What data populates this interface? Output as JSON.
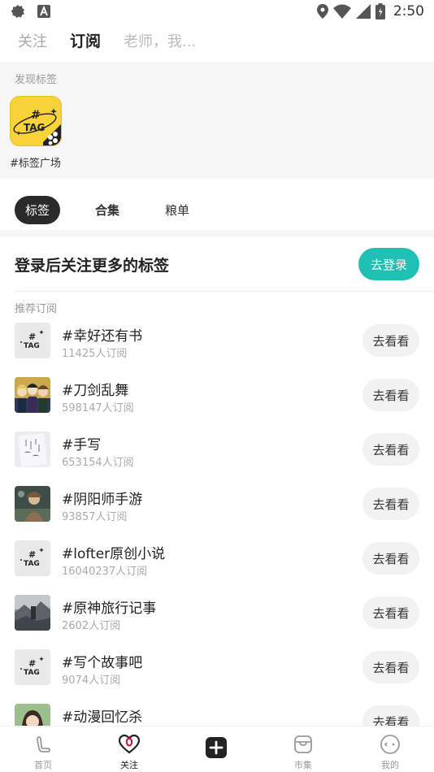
{
  "status_bar": {
    "time": "2:50"
  },
  "top_tabs": [
    {
      "label": "关注"
    },
    {
      "label": "订阅"
    },
    {
      "label": "老师，我..."
    }
  ],
  "discover": {
    "title": "发现标签",
    "tag_plaza": {
      "icon_text": "TAG",
      "label": "#标签广场"
    }
  },
  "segments": [
    {
      "label": "标签"
    },
    {
      "label": "合集"
    },
    {
      "label": "粮单"
    }
  ],
  "login_banner": {
    "text": "登录后关注更多的标签",
    "button": "去登录"
  },
  "recommend": {
    "title": "推荐订阅",
    "button_label": "去看看",
    "items": [
      {
        "title": "#幸好还有书",
        "subscribers": "11425人订阅",
        "thumb": "tag"
      },
      {
        "title": "#刀剑乱舞",
        "subscribers": "598147人订阅",
        "thumb": "photo-anime-group"
      },
      {
        "title": "#手写",
        "subscribers": "653154人订阅",
        "thumb": "photo-handwriting"
      },
      {
        "title": "#阴阳师手游",
        "subscribers": "93857人订阅",
        "thumb": "photo-game-art"
      },
      {
        "title": "#lofter原创小说",
        "subscribers": "16040237人订阅",
        "thumb": "tag"
      },
      {
        "title": "#原神旅行记事",
        "subscribers": "2602人订阅",
        "thumb": "photo-landscape"
      },
      {
        "title": "#写个故事吧",
        "subscribers": "9074人订阅",
        "thumb": "tag"
      },
      {
        "title": "#动漫回忆杀",
        "subscribers": "",
        "thumb": "photo-anime-girl"
      }
    ]
  },
  "bottom_nav": [
    {
      "label": "首页",
      "icon": "home-icon"
    },
    {
      "label": "关注",
      "icon": "heart-icon"
    },
    {
      "label": "",
      "icon": "publish-plus-icon"
    },
    {
      "label": "市集",
      "icon": "market-icon"
    },
    {
      "label": "我的",
      "icon": "profile-icon"
    }
  ],
  "colors": {
    "accent": "#21c0b4",
    "tag_yellow": "#f7d238",
    "active_segment": "#2a2a2a"
  }
}
